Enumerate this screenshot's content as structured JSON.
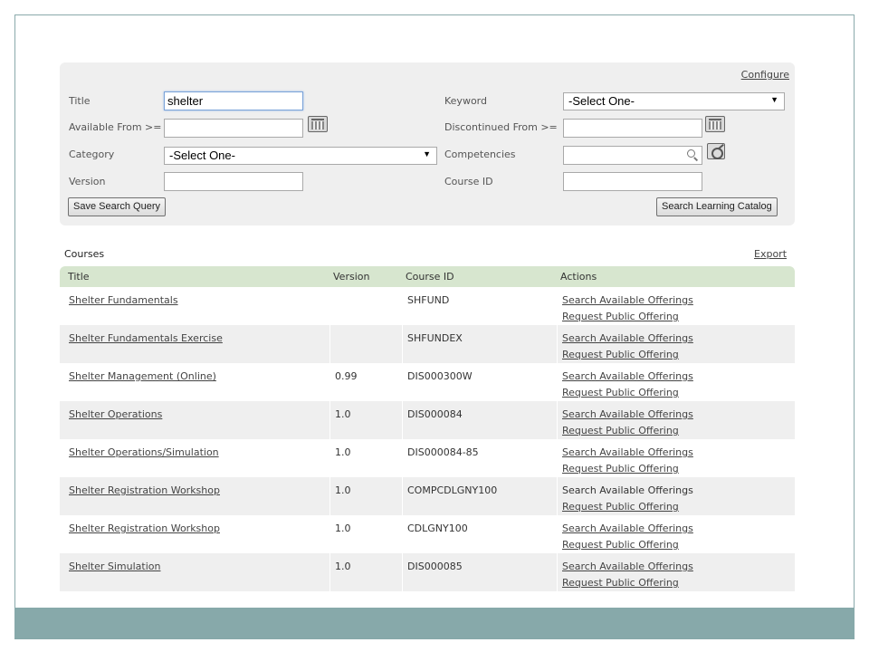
{
  "search": {
    "configure_label": "Configure",
    "title_label": "Title",
    "title_value": "shelter",
    "keyword_label": "Keyword",
    "keyword_value": "-Select One-",
    "available_from_label": "Available From >=",
    "available_from_value": "",
    "discontinued_from_label": "Discontinued From >=",
    "discontinued_from_value": "",
    "category_label": "Category",
    "category_value": "-Select One-",
    "competencies_label": "Competencies",
    "competencies_value": "",
    "version_label": "Version",
    "version_value": "",
    "course_id_label": "Course ID",
    "course_id_value": "",
    "save_query_label": "Save Search Query",
    "search_button_label": "Search Learning Catalog"
  },
  "courses": {
    "section_title": "Courses",
    "export_label": "Export",
    "columns": [
      "Title",
      "Version",
      "Course ID",
      "Actions"
    ],
    "rows": [
      {
        "title": "Shelter Fundamentals",
        "version": "",
        "course_id": "SHFUND",
        "action1": "Search Available Offerings",
        "action2": "Request Public Offering"
      },
      {
        "title": "Shelter Fundamentals Exercise",
        "version": "",
        "course_id": "SHFUNDEX",
        "action1": "Search Available Offerings",
        "action2": "Request Public Offering"
      },
      {
        "title": "Shelter Management (Online)",
        "version": "0.99",
        "course_id": "DIS000300W",
        "action1": "Search Available Offerings",
        "action2": "Request Public Offering"
      },
      {
        "title": "Shelter Operations",
        "version": "1.0",
        "course_id": "DIS000084",
        "action1": "Search Available Offerings",
        "action2": "Request Public Offering"
      },
      {
        "title": "Shelter Operations/Simulation",
        "version": "1.0",
        "course_id": "DIS000084-85",
        "action1": "Search Available Offerings",
        "action2": "Request Public Offering"
      },
      {
        "title": "Shelter Registration Workshop",
        "version": "1.0",
        "course_id": "COMPCDLGNY100",
        "action1": "Search Available Offerings",
        "action2": "Request Public Offering"
      },
      {
        "title": "Shelter Registration Workshop",
        "version": "1.0",
        "course_id": "CDLGNY100",
        "action1": "Search Available Offerings",
        "action2": "Request Public Offering"
      },
      {
        "title": "Shelter Simulation",
        "version": "1.0",
        "course_id": "DIS000085",
        "action1": "Search Available Offerings",
        "action2": "Request Public Offering"
      }
    ]
  },
  "colors": {
    "header_green": "#d7e6cf",
    "band_teal": "#87a9aa",
    "panel_gray": "#efefef"
  }
}
